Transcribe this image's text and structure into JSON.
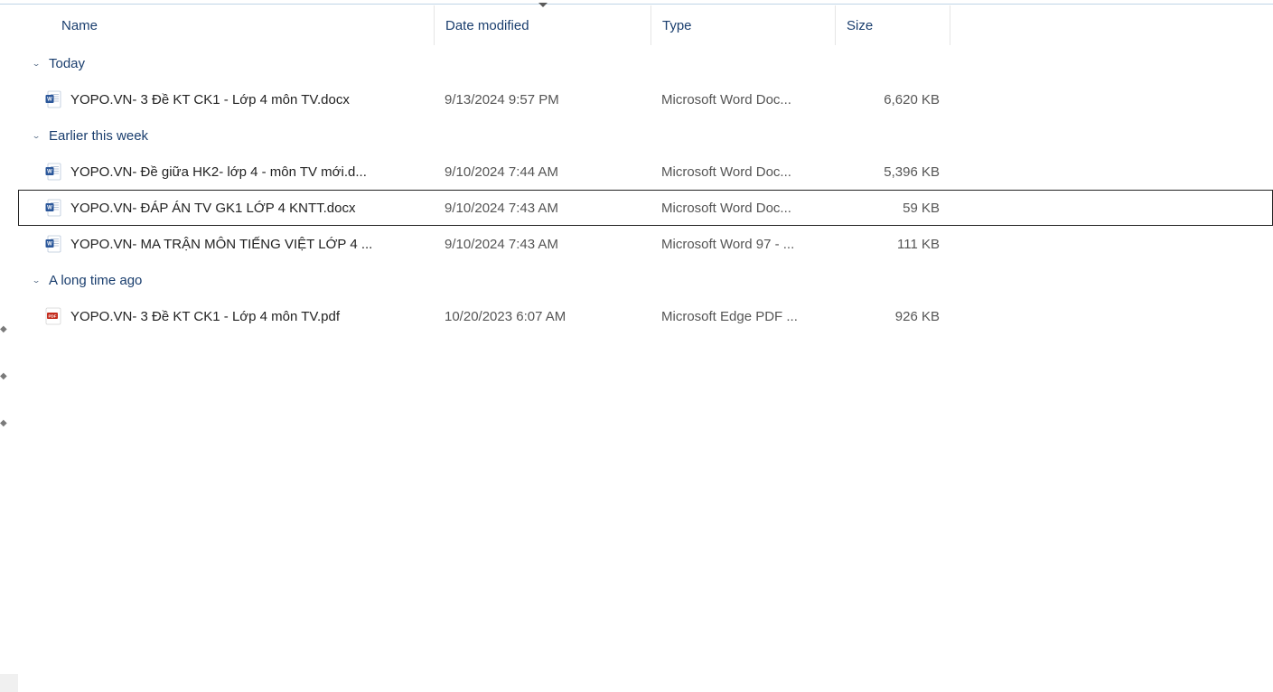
{
  "columns": {
    "name": "Name",
    "date": "Date modified",
    "type": "Type",
    "size": "Size"
  },
  "groups": [
    {
      "label": "Today",
      "files": [
        {
          "name": "YOPO.VN- 3 Đề KT CK1 - Lớp 4 môn TV.docx",
          "date": "9/13/2024 9:57 PM",
          "type": "Microsoft Word Doc...",
          "size": "6,620 KB",
          "icon": "docx",
          "selected": false
        }
      ]
    },
    {
      "label": "Earlier this week",
      "files": [
        {
          "name": "YOPO.VN- Đề giữa HK2- lớp 4 - môn TV mới.d...",
          "date": "9/10/2024 7:44 AM",
          "type": "Microsoft Word Doc...",
          "size": "5,396 KB",
          "icon": "docx",
          "selected": false
        },
        {
          "name": "YOPO.VN- ĐÁP ÁN TV GK1 LỚP 4 KNTT.docx",
          "date": "9/10/2024 7:43 AM",
          "type": "Microsoft Word Doc...",
          "size": "59 KB",
          "icon": "docx",
          "selected": true
        },
        {
          "name": "YOPO.VN- MA TRẬN  MÔN TIẾNG VIỆT LỚP 4 ...",
          "date": "9/10/2024 7:43 AM",
          "type": "Microsoft Word 97 - ...",
          "size": "111 KB",
          "icon": "doc",
          "selected": false
        }
      ]
    },
    {
      "label": "A long time ago",
      "files": [
        {
          "name": "YOPO.VN- 3 Đề KT CK1 - Lớp 4 môn TV.pdf",
          "date": "10/20/2023 6:07 AM",
          "type": "Microsoft Edge PDF ...",
          "size": "926 KB",
          "icon": "pdf",
          "selected": false
        }
      ]
    }
  ]
}
